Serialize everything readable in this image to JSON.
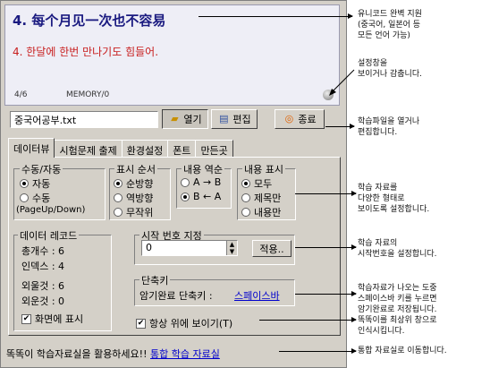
{
  "display": {
    "title": "4. 每个月见一次也不容易",
    "subtitle": "4. 한달에 한번 만나기도 힘들어.",
    "count": "4/6",
    "memory": "MEMORY/0"
  },
  "file": {
    "value": "중국어공부.txt",
    "open_label": "열기",
    "edit_label": "편집",
    "exit_label": "종료"
  },
  "tabs": [
    "데이터뷰",
    "시험문제 출제",
    "환경설정",
    "폰트",
    "만든곳"
  ],
  "study_mode": {
    "title": "수동/자동",
    "options": [
      "자동",
      "수동"
    ],
    "note": "(PageUp/Down)",
    "selected": "자동"
  },
  "order": {
    "title": "표시 순서",
    "options": [
      "순방향",
      "역방향",
      "무작위"
    ],
    "selected": "순방향"
  },
  "content_reverse": {
    "title": "내용 역순",
    "options": [
      "A → B",
      "B ← A"
    ],
    "selected": "B ← A"
  },
  "content_display": {
    "title": "내용 표시",
    "options": [
      "모두",
      "제목만",
      "내용만"
    ],
    "selected": "모두"
  },
  "records": {
    "title": "데이터 레코드",
    "total": "총개수 : 6",
    "index": "인덱스 : 4",
    "memorized_out": "외울것 : 6",
    "memorized_in": "외운것 : 0",
    "show_on_screen": "화면에 표시"
  },
  "start_number": {
    "title": "시작 번호 지정",
    "value": "0",
    "apply_label": "적용.."
  },
  "shortcut": {
    "title": "단축키",
    "label": "암기완료 단축키 :",
    "key": "스페이스바"
  },
  "always_on_top": "항상 위에 보이기(T)",
  "footer": {
    "text": "똑똑이 학습자료실을 활용하세요!!",
    "link": "통합 학습 자료실"
  },
  "annotations": [
    [
      "유니코드 완벽 지원",
      "(중국어, 일본어 등",
      " 모든 언어 가능)"
    ],
    [
      "설정창을",
      "보이거나 감춥니다."
    ],
    [
      "학습파일을 열거나",
      "편집합니다."
    ],
    [
      "학습 자료를",
      "다양한 형태로",
      "보이도록 설정합니다."
    ],
    [
      "학습 자료의",
      "시작번호을 설정합니다."
    ],
    [
      "학습자료가 나오는 도중",
      "스페이스바 키를 누르면",
      "암기완료로 저장됩니다."
    ],
    [
      "똑똑이를 최상위 창으로",
      "인식시킵니다."
    ],
    [
      "통합 자료실로 이동합니다."
    ]
  ]
}
